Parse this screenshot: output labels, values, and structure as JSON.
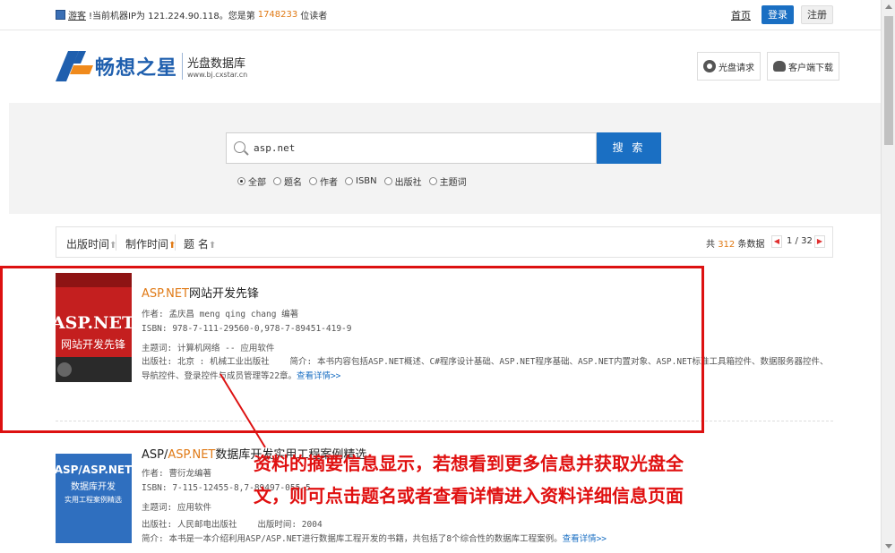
{
  "topbar": {
    "visitor_link": "游客",
    "ip_text": "!当前机器IP为 121.224.90.118。您是第",
    "visitor_count": "1748233",
    "suffix": "位读者",
    "home": "首页",
    "login": "登录",
    "register": "注册"
  },
  "header": {
    "brand": "畅想之星",
    "subtitle": "光盘数据库",
    "url": "www.bj.cxstar.cn",
    "disc_request": "光盘请求",
    "client_download": "客户端下载"
  },
  "search": {
    "query": "asp.net",
    "button": "搜 索",
    "options": [
      "全部",
      "题名",
      "作者",
      "ISBN",
      "出版社",
      "主题词"
    ],
    "selected": "全部"
  },
  "sort": {
    "pub_time": "出版时间",
    "make_time": "制作时间",
    "title": "题 名",
    "total_prefix": "共",
    "total": "312",
    "total_suffix": "条数据",
    "page": "1 / 32"
  },
  "results": [
    {
      "title_hl": "ASP.NET",
      "title_rest": "网站开发先锋",
      "author": "作者: 孟庆昌 meng qing chang 编著",
      "isbn": "ISBN: 978-7-111-29560-0,978-7-89451-419-9",
      "subject": "主题词: 计算机网络 -- 应用软件",
      "publisher": "出版社: 北京 : 机械工业出版社",
      "intro": "简介: 本书内容包括ASP.NET概述、C#程序设计基础、ASP.NET程序基础、ASP.NET内置对象、ASP.NET标准工具箱控件、数据服务器控件、导航控件、登录控件与成员管理等22章。",
      "more": "查看详情>>",
      "cover_title1": "ASP.NET",
      "cover_title2": "网站开发先锋"
    },
    {
      "title_pre": "ASP/",
      "title_hl": "ASP.NET",
      "title_rest": "数据库开发实用工程案例精选",
      "author": "作者: 曹衍龙编著",
      "isbn": "ISBN: 7-115-12455-8,7-89497-055-5",
      "subject": "主题词: 应用软件",
      "publisher": "出版社: 人民邮电出版社",
      "pubtime": "出版时间: 2004",
      "intro": "简介: 本书是一本介绍利用ASP/ASP.NET进行数据库工程开发的书籍，共包括了8个综合性的数据库工程案例。",
      "more": "查看详情>>",
      "cover_title1": "ASP/ASP.NET",
      "cover_title2": "数据库开发",
      "cover_title3": "实用工程案例精选"
    }
  ],
  "annotation": {
    "line1": "资料的摘要信息显示，若想看到更多信息并获取光盘全",
    "line2": "文，则可点击题名或者查看详情进入资料详细信息页面"
  },
  "colors": {
    "accent": "#1a6fc3",
    "highlight": "#e07a16",
    "annotation": "#e01010"
  }
}
